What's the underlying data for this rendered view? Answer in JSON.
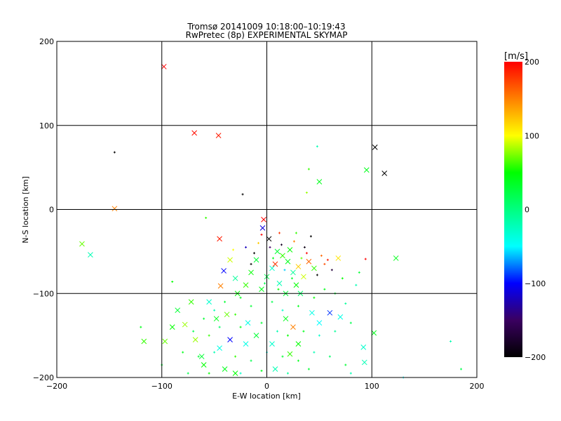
{
  "chart_data": {
    "type": "scatter",
    "title": "Tromsø 20141009 10:18:00–10:19:43",
    "subtitle": "RwPretec (8p) EXPERIMENTAL SKYMAP",
    "xlabel": "E-W location [km]",
    "ylabel": "N-S location [km]",
    "xlim": [
      -200,
      200
    ],
    "ylim": [
      -200,
      200
    ],
    "xticks": [
      -200,
      -100,
      0,
      100,
      200
    ],
    "yticks": [
      -200,
      -100,
      0,
      100,
      200
    ],
    "xtick_labels": [
      "−200",
      "−100",
      "0",
      "100",
      "200"
    ],
    "ytick_labels": [
      "−200",
      "−100",
      "0",
      "100",
      "200"
    ],
    "grid": true,
    "colorbar": {
      "label": "[m/s]",
      "range": [
        -200,
        200
      ],
      "ticks": [
        200,
        100,
        0,
        -100,
        -200
      ],
      "tick_labels": [
        "200",
        "100",
        "0",
        "−100",
        "−200"
      ],
      "colors": [
        {
          "v": -200,
          "c": "#000000"
        },
        {
          "v": -150,
          "c": "#3a0060"
        },
        {
          "v": -100,
          "c": "#0000ff"
        },
        {
          "v": -50,
          "c": "#00ffff"
        },
        {
          "v": 0,
          "c": "#00ff80"
        },
        {
          "v": 50,
          "c": "#00ff00"
        },
        {
          "v": 100,
          "c": "#ffff00"
        },
        {
          "v": 150,
          "c": "#ff8000"
        },
        {
          "v": 200,
          "c": "#ff0000"
        }
      ]
    },
    "points_format": [
      "x_km",
      "y_km",
      "velocity_ms",
      "large_marker"
    ],
    "points": [
      [
        -98,
        170,
        200,
        1
      ],
      [
        -69,
        91,
        195,
        1
      ],
      [
        -46,
        88,
        190,
        1
      ],
      [
        -145,
        68,
        -200,
        0
      ],
      [
        103,
        74,
        -200,
        1
      ],
      [
        112,
        43,
        -200,
        1
      ],
      [
        95,
        47,
        40,
        1
      ],
      [
        50,
        33,
        40,
        1
      ],
      [
        -23,
        18,
        -200,
        0
      ],
      [
        -145,
        1,
        150,
        1
      ],
      [
        -176,
        -41,
        70,
        1
      ],
      [
        -168,
        -54,
        -20,
        1
      ],
      [
        123,
        -58,
        40,
        1
      ],
      [
        -3,
        -12,
        200,
        1
      ],
      [
        -4,
        -22,
        -110,
        1
      ],
      [
        -41,
        -73,
        -100,
        1
      ],
      [
        -45,
        -35,
        190,
        1
      ],
      [
        -44,
        -91,
        150,
        1
      ],
      [
        68,
        -58,
        110,
        1
      ],
      [
        94,
        -59,
        200,
        0
      ],
      [
        -117,
        -157,
        60,
        1
      ],
      [
        -97,
        -157,
        70,
        1
      ],
      [
        -78,
        -137,
        80,
        1
      ],
      [
        -68,
        -155,
        80,
        1
      ],
      [
        92,
        -164,
        -30,
        1
      ],
      [
        93,
        -182,
        -20,
        1
      ],
      [
        102,
        -147,
        40,
        1
      ],
      [
        43,
        -123,
        -40,
        1
      ],
      [
        60,
        -123,
        -90,
        1
      ],
      [
        25,
        -140,
        150,
        1
      ],
      [
        -35,
        -155,
        -100,
        1
      ],
      [
        -60,
        -185,
        50,
        1
      ],
      [
        -40,
        -190,
        40,
        1
      ],
      [
        -20,
        -160,
        -40,
        1
      ],
      [
        40,
        48,
        60,
        0
      ],
      [
        48,
        75,
        -20,
        0
      ],
      [
        38,
        20,
        80,
        0
      ],
      [
        -58,
        -10,
        60,
        0
      ],
      [
        -90,
        -86,
        50,
        0
      ],
      [
        -120,
        -140,
        40,
        0
      ],
      [
        -100,
        -185,
        30,
        0
      ],
      [
        130,
        -200,
        -50,
        0
      ],
      [
        175,
        -157,
        -20,
        0
      ],
      [
        185,
        -190,
        20,
        0
      ],
      [
        2,
        -35,
        -200,
        1
      ],
      [
        10,
        -50,
        30,
        1
      ],
      [
        15,
        -55,
        60,
        1
      ],
      [
        20,
        -62,
        40,
        1
      ],
      [
        5,
        -70,
        -30,
        1
      ],
      [
        25,
        -75,
        -10,
        1
      ],
      [
        30,
        -68,
        120,
        1
      ],
      [
        -10,
        -60,
        30,
        1
      ],
      [
        -15,
        -75,
        50,
        1
      ],
      [
        0,
        -80,
        20,
        1
      ],
      [
        12,
        -88,
        -20,
        1
      ],
      [
        28,
        -90,
        50,
        1
      ],
      [
        35,
        -80,
        90,
        1
      ],
      [
        40,
        -62,
        160,
        1
      ],
      [
        45,
        -70,
        60,
        1
      ],
      [
        -5,
        -95,
        40,
        1
      ],
      [
        18,
        -100,
        30,
        1
      ],
      [
        32,
        -100,
        10,
        1
      ],
      [
        -20,
        -90,
        60,
        1
      ],
      [
        -30,
        -82,
        -10,
        1
      ],
      [
        8,
        -65,
        180,
        1
      ],
      [
        22,
        -48,
        50,
        1
      ],
      [
        3,
        -45,
        -150,
        0
      ],
      [
        -8,
        -40,
        120,
        0
      ],
      [
        14,
        -42,
        -180,
        0
      ],
      [
        26,
        -38,
        150,
        0
      ],
      [
        36,
        -45,
        -190,
        0
      ],
      [
        42,
        -32,
        -200,
        0
      ],
      [
        55,
        -65,
        170,
        0
      ],
      [
        58,
        -60,
        190,
        0
      ],
      [
        48,
        -78,
        -200,
        0
      ],
      [
        -12,
        -52,
        -200,
        0
      ],
      [
        6,
        -58,
        40,
        0
      ],
      [
        17,
        -72,
        -60,
        0
      ],
      [
        24,
        -82,
        30,
        0
      ],
      [
        -2,
        -88,
        20,
        0
      ],
      [
        33,
        -58,
        70,
        0
      ],
      [
        11,
        -95,
        50,
        0
      ],
      [
        -25,
        -105,
        40,
        0
      ],
      [
        -40,
        -110,
        30,
        0
      ],
      [
        -50,
        -120,
        -20,
        0
      ],
      [
        -30,
        -125,
        60,
        0
      ],
      [
        -15,
        -115,
        30,
        0
      ],
      [
        5,
        -110,
        20,
        0
      ],
      [
        15,
        -120,
        -30,
        0
      ],
      [
        30,
        -115,
        40,
        0
      ],
      [
        45,
        -105,
        50,
        0
      ],
      [
        55,
        -95,
        40,
        0
      ],
      [
        65,
        -100,
        30,
        0
      ],
      [
        75,
        -112,
        -10,
        0
      ],
      [
        -60,
        -130,
        30,
        0
      ],
      [
        -70,
        -145,
        20,
        0
      ],
      [
        -55,
        -150,
        60,
        0
      ],
      [
        -45,
        -140,
        10,
        0
      ],
      [
        -25,
        -140,
        40,
        0
      ],
      [
        -5,
        -135,
        30,
        0
      ],
      [
        10,
        -145,
        -20,
        0
      ],
      [
        20,
        -150,
        50,
        0
      ],
      [
        35,
        -145,
        40,
        0
      ],
      [
        50,
        -150,
        -30,
        0
      ],
      [
        65,
        -145,
        -10,
        0
      ],
      [
        80,
        -135,
        20,
        0
      ],
      [
        -80,
        -170,
        40,
        0
      ],
      [
        -65,
        -175,
        30,
        0
      ],
      [
        -50,
        -170,
        -20,
        0
      ],
      [
        -30,
        -175,
        60,
        0
      ],
      [
        -15,
        -180,
        20,
        0
      ],
      [
        0,
        -170,
        -40,
        0
      ],
      [
        15,
        -175,
        30,
        0
      ],
      [
        30,
        -180,
        40,
        0
      ],
      [
        45,
        -170,
        -20,
        0
      ],
      [
        60,
        -175,
        10,
        0
      ],
      [
        75,
        -185,
        30,
        0
      ],
      [
        -75,
        -195,
        20,
        0
      ],
      [
        -55,
        -195,
        50,
        0
      ],
      [
        -25,
        -195,
        -30,
        0
      ],
      [
        -5,
        -192,
        40,
        0
      ],
      [
        20,
        -195,
        -10,
        0
      ],
      [
        40,
        -190,
        30,
        0
      ],
      [
        80,
        -195,
        -20,
        0
      ],
      [
        -35,
        -60,
        90,
        1
      ],
      [
        -28,
        -100,
        50,
        1
      ],
      [
        -55,
        -110,
        -30,
        1
      ],
      [
        -48,
        -130,
        40,
        1
      ],
      [
        -38,
        -125,
        70,
        1
      ],
      [
        -18,
        -135,
        -40,
        1
      ],
      [
        -10,
        -150,
        30,
        1
      ],
      [
        5,
        -160,
        -30,
        1
      ],
      [
        18,
        -130,
        40,
        1
      ],
      [
        30,
        -160,
        50,
        1
      ],
      [
        -45,
        -165,
        -40,
        1
      ],
      [
        -30,
        -195,
        50,
        1
      ],
      [
        -62,
        -175,
        30,
        1
      ],
      [
        8,
        -190,
        -20,
        1
      ],
      [
        22,
        -172,
        60,
        1
      ],
      [
        50,
        -135,
        -50,
        1
      ],
      [
        70,
        -128,
        -40,
        1
      ],
      [
        -72,
        -110,
        60,
        1
      ],
      [
        -90,
        -140,
        50,
        1
      ],
      [
        -85,
        -120,
        30,
        1
      ],
      [
        -20,
        -45,
        -120,
        0
      ],
      [
        -32,
        -48,
        100,
        0
      ],
      [
        -5,
        -30,
        200,
        0
      ],
      [
        12,
        -28,
        180,
        0
      ],
      [
        28,
        -28,
        60,
        0
      ],
      [
        -15,
        -65,
        -200,
        0
      ],
      [
        38,
        -52,
        200,
        0
      ],
      [
        52,
        -55,
        160,
        0
      ],
      [
        62,
        -72,
        -170,
        0
      ],
      [
        72,
        -82,
        50,
        0
      ],
      [
        85,
        -90,
        -20,
        0
      ],
      [
        88,
        -75,
        30,
        0
      ]
    ]
  }
}
